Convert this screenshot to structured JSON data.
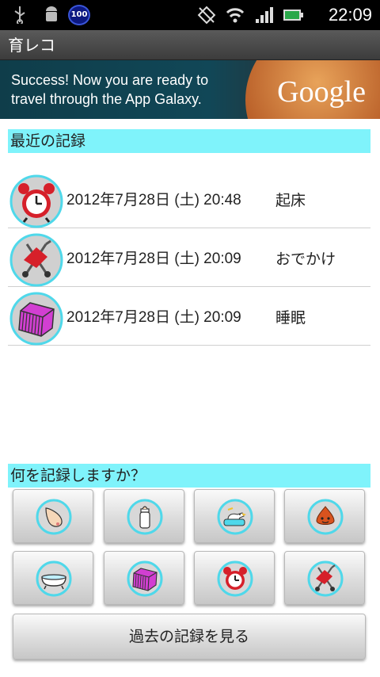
{
  "status_bar": {
    "badge": "100",
    "time": "22:09"
  },
  "app": {
    "title": "育レコ"
  },
  "ad": {
    "text_line1": "Success! Now you are ready to",
    "text_line2": "travel through the App Galaxy.",
    "logo": "Google"
  },
  "recent": {
    "header": "最近の記録",
    "records": [
      {
        "icon": "alarm-clock-icon",
        "date": "2012年7月28日 (土) 20:48",
        "type": "起床"
      },
      {
        "icon": "stroller-icon",
        "date": "2012年7月28日 (土) 20:09",
        "type": "おでかけ"
      },
      {
        "icon": "crib-icon",
        "date": "2012年7月28日 (土) 20:09",
        "type": "睡眠"
      }
    ]
  },
  "record_prompt": {
    "header": "何を記録しますか？",
    "buttons": [
      {
        "icon": "breastfeeding-icon"
      },
      {
        "icon": "baby-bottle-icon"
      },
      {
        "icon": "potty-duck-icon"
      },
      {
        "icon": "poop-icon"
      },
      {
        "icon": "bathtub-icon"
      },
      {
        "icon": "crib-icon"
      },
      {
        "icon": "alarm-clock-icon"
      },
      {
        "icon": "stroller-icon"
      }
    ]
  },
  "history_button": {
    "label": "過去の記録を見る"
  },
  "colors": {
    "section_header_bg": "#7ff3fb",
    "icon_ring": "#4fd8ea",
    "crib_purple": "#d23fd2",
    "clock_red": "#d6202a"
  }
}
